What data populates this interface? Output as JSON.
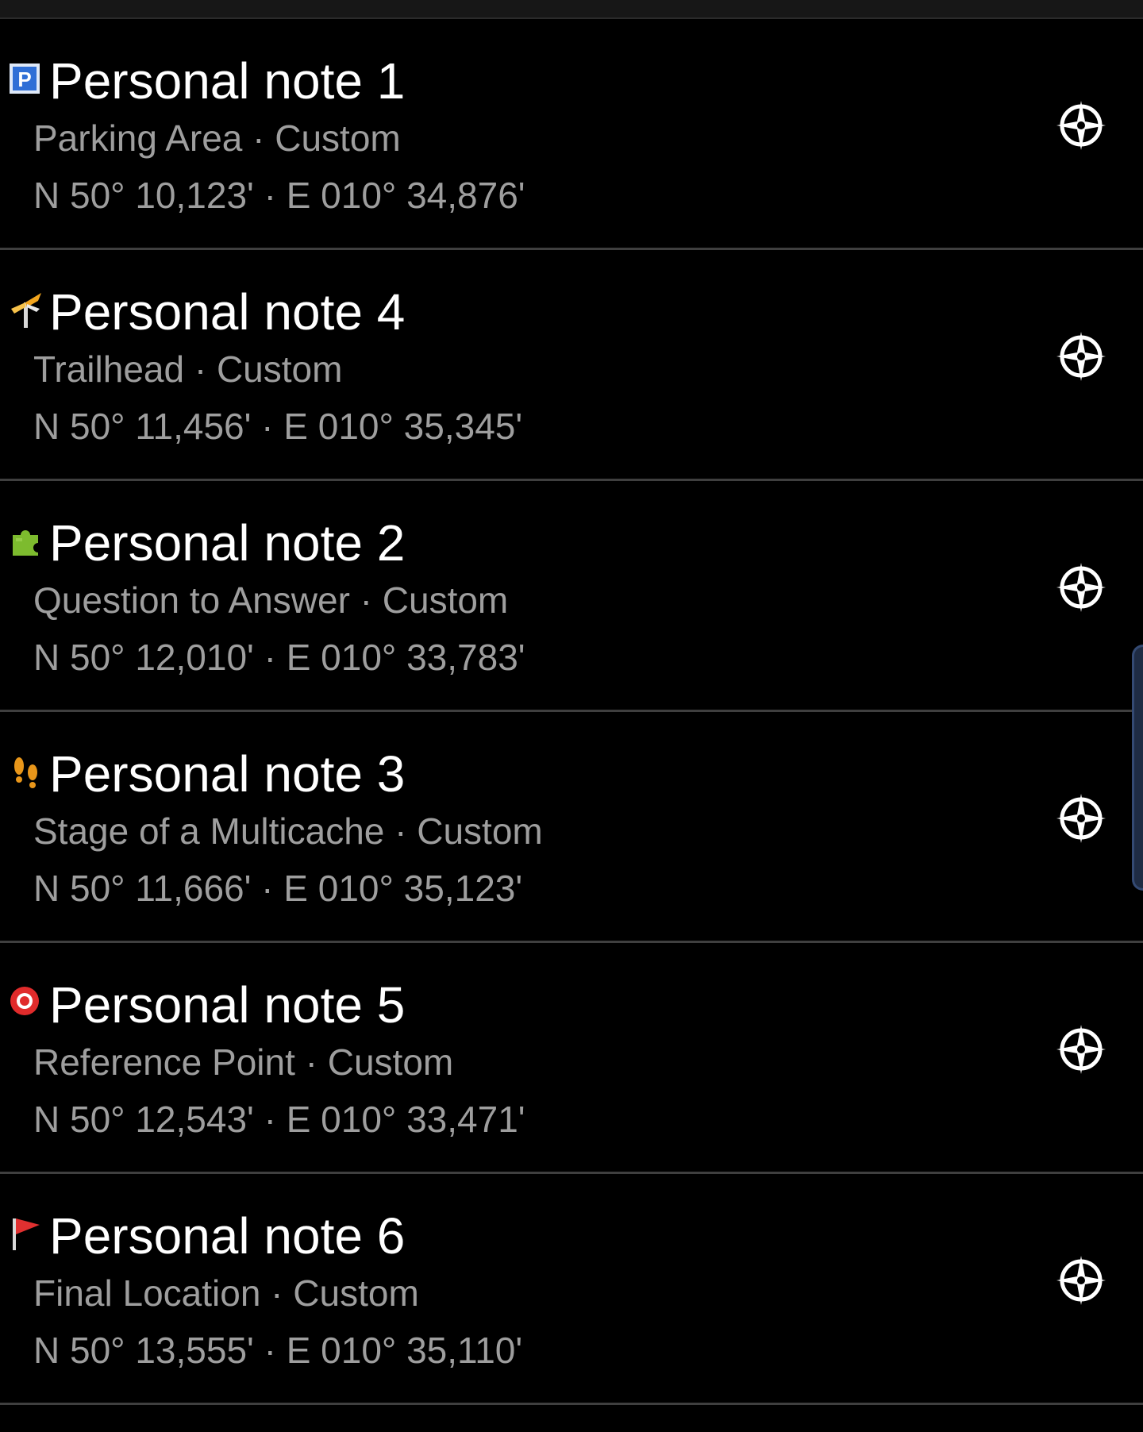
{
  "waypoints": [
    {
      "title": "Personal note 1",
      "subtitle": "Parking Area · Custom",
      "coords": "N 50° 10,123' · E 010° 34,876'",
      "icon": "parking-icon",
      "icon_label": "P"
    },
    {
      "title": "Personal note 4",
      "subtitle": "Trailhead · Custom",
      "coords": "N 50° 11,456' · E 010° 35,345'",
      "icon": "trailhead-icon"
    },
    {
      "title": "Personal note 2",
      "subtitle": "Question to Answer · Custom",
      "coords": "N 50° 12,010' · E 010° 33,783'",
      "icon": "puzzle-icon"
    },
    {
      "title": "Personal note 3",
      "subtitle": "Stage of a Multicache · Custom",
      "coords": "N 50° 11,666' · E 010° 35,123'",
      "icon": "footprints-icon"
    },
    {
      "title": "Personal note 5",
      "subtitle": "Reference Point · Custom",
      "coords": "N 50° 12,543' · E 010° 33,471'",
      "icon": "reference-point-icon"
    },
    {
      "title": "Personal note 6",
      "subtitle": "Final Location · Custom",
      "coords": "N 50° 13,555' · E 010° 35,110'",
      "icon": "final-flag-icon"
    }
  ],
  "nav_icon": "compass-navigate-icon",
  "colors": {
    "background": "#000000",
    "title": "#ffffff",
    "secondary_text": "#9e9e9e",
    "divider": "#3f3f3f",
    "parking_blue": "#2f6fd6",
    "trailhead_orange": "#f2a51e",
    "puzzle_green": "#7dbb2e",
    "multicache_orange": "#e8961a",
    "reference_red": "#e02b2b",
    "flag_red": "#e03030"
  }
}
